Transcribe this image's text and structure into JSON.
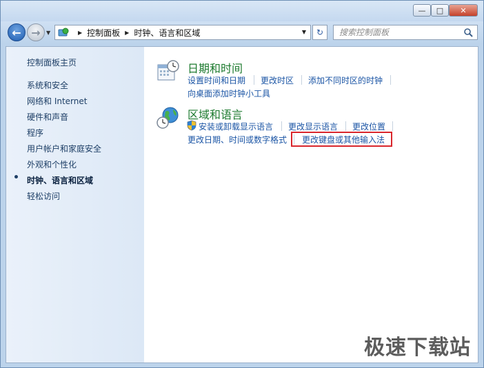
{
  "window": {
    "minimize_glyph": "—",
    "maximize_glyph": "□",
    "close_glyph": "✕"
  },
  "nav": {
    "back_glyph": "←",
    "forward_glyph": "→",
    "dropdown_glyph": "▼",
    "refresh_glyph": "↻"
  },
  "address": {
    "path": [
      "控制面板",
      "时钟、语言和区域"
    ],
    "separator_glyph": "▶",
    "dropdown_glyph": "▼"
  },
  "search": {
    "placeholder": "搜索控制面板"
  },
  "sidebar": {
    "home": "控制面板主页",
    "items": [
      {
        "label": "系统和安全"
      },
      {
        "label": "网络和 Internet"
      },
      {
        "label": "硬件和声音"
      },
      {
        "label": "程序"
      },
      {
        "label": "用户帐户和家庭安全"
      },
      {
        "label": "外观和个性化"
      },
      {
        "label": "时钟、语言和区域",
        "active": true
      },
      {
        "label": "轻松访问"
      }
    ]
  },
  "categories": {
    "datetime": {
      "title": "日期和时间",
      "links": [
        "设置时间和日期",
        "更改时区",
        "添加不同时区的时钟",
        "向桌面添加时钟小工具"
      ]
    },
    "region": {
      "title": "区域和语言",
      "links": [
        "安装或卸载显示语言",
        "更改显示语言",
        "更改位置",
        "更改日期、时间或数字格式",
        "更改键盘或其他输入法"
      ]
    }
  },
  "watermark": "极速下载站"
}
